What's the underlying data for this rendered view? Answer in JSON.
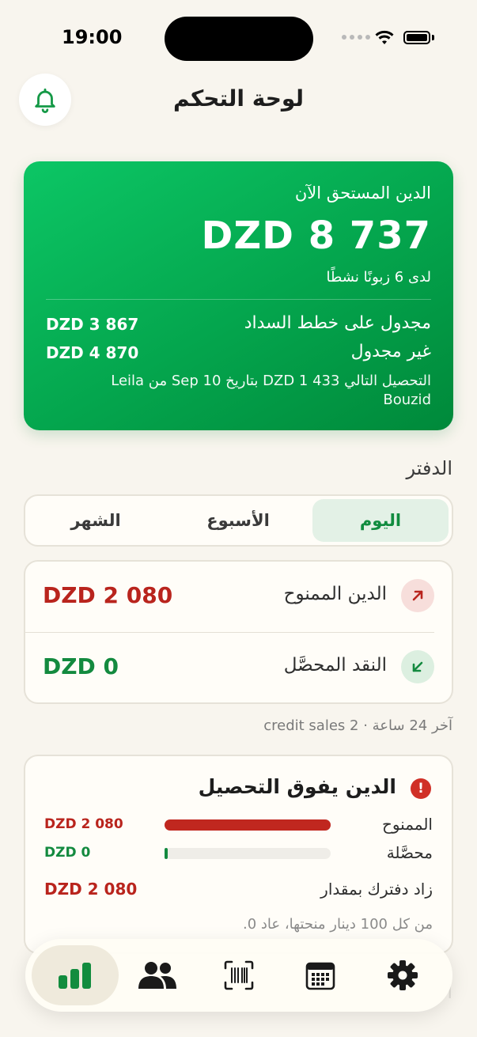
{
  "status": {
    "time": "19:00"
  },
  "header": {
    "title": "لوحة التحكم",
    "bell_icon": "bell-icon"
  },
  "hero": {
    "label": "الدين المستحق الآن",
    "amount": "DZD 8 737",
    "subtitle": "لدى 6 زبونًا نشطًا",
    "rows": [
      {
        "label": "مجدول على خطط السداد",
        "value": "DZD 3 867"
      },
      {
        "label": "غير مجدول",
        "value": "DZD 4 870"
      }
    ],
    "next_collection": "التحصيل التالي DZD 1 433 بتاريخ Sep 10 من Leila Bouzid"
  },
  "ledger": {
    "title": "الدفتر",
    "tabs": [
      {
        "label": "اليوم",
        "active": true
      },
      {
        "label": "الأسبوع",
        "active": false
      },
      {
        "label": "الشهر",
        "active": false
      }
    ],
    "stats": [
      {
        "label": "الدين الممنوح",
        "value": "DZD 2 080",
        "icon": "arrow-up-right-icon",
        "color": "#b9241d"
      },
      {
        "label": "النقد المحصَّل",
        "value": "DZD 0",
        "icon": "arrow-down-left-icon",
        "color": "#138a3f"
      }
    ],
    "meta": "آخر 24 ساعة · 2 credit sales"
  },
  "compare": {
    "title": "الدين يفوق التحصيل",
    "alert_icon": "alert-icon",
    "bars": [
      {
        "label": "الممنوح",
        "value": "DZD 2 080",
        "fraction": 1.0,
        "color": "#c0271f"
      },
      {
        "label": "محصَّلة",
        "value": "DZD 0",
        "fraction": 0.0,
        "color": "#138a3f"
      }
    ],
    "summary_label": "زاد دفترك بمقدار",
    "summary_value": "DZD 2 080",
    "note": "من كل 100 دينار منحتها، عاد 0."
  },
  "ghost_text": "ا",
  "tabbar": {
    "items": [
      {
        "name": "dashboard",
        "icon": "bar-chart-icon",
        "active": true
      },
      {
        "name": "customers",
        "icon": "users-icon",
        "active": false
      },
      {
        "name": "scan",
        "icon": "barcode-scan-icon",
        "active": false
      },
      {
        "name": "calendar",
        "icon": "calendar-icon",
        "active": false
      },
      {
        "name": "settings",
        "icon": "gear-icon",
        "active": false
      }
    ]
  }
}
